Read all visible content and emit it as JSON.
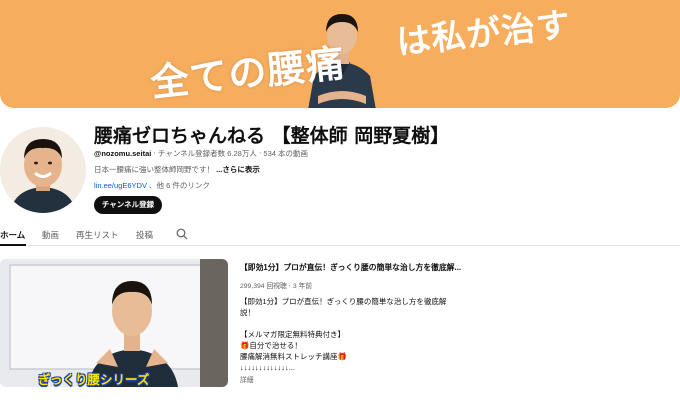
{
  "banner": {
    "text_left": "全ての腰痛",
    "text_right": "は私が治す",
    "color": "#f6ad5e"
  },
  "channel": {
    "avatar_icon": "person-avatar",
    "title": "腰痛ゼロちゃんねる 【整体師 岡野夏樹】",
    "handle": "@nozomu.seitai",
    "subscribers": "チャンネル登録者数 6.28万人",
    "video_count": "534 本の動画",
    "description": "日本一腰痛に強い整体師岡野です！",
    "description_more": "...さらに表示",
    "link": "lin.ee/ugE6YDV",
    "link_more": "、他 6 件のリンク",
    "subscribe_label": "チャンネル登録"
  },
  "tabs": {
    "items": [
      {
        "label": "ホーム",
        "active": true
      },
      {
        "label": "動画",
        "active": false
      },
      {
        "label": "再生リスト",
        "active": false
      },
      {
        "label": "投稿",
        "active": false
      }
    ],
    "search_icon": "search-icon"
  },
  "featured": {
    "thumbnail_label": "ぎっくり腰シリーズ",
    "title": "【即効1分】プロが直伝！ぎっくり腰の簡単な治し方を徹底解...",
    "views": "299,394 回視聴",
    "age": "3 年前",
    "description_lines": [
      "【即効1分】プロが直伝！ぎっくり腰の簡単な治し方を徹底解",
      "説！",
      "",
      "【メルマガ限定無料特典付き】",
      "🎁自分で治せる！",
      "腰痛解消無料ストレッチ講座🎁",
      "↓↓↓↓↓↓↓↓↓↓↓↓↓..."
    ],
    "more_label": "詳細"
  }
}
